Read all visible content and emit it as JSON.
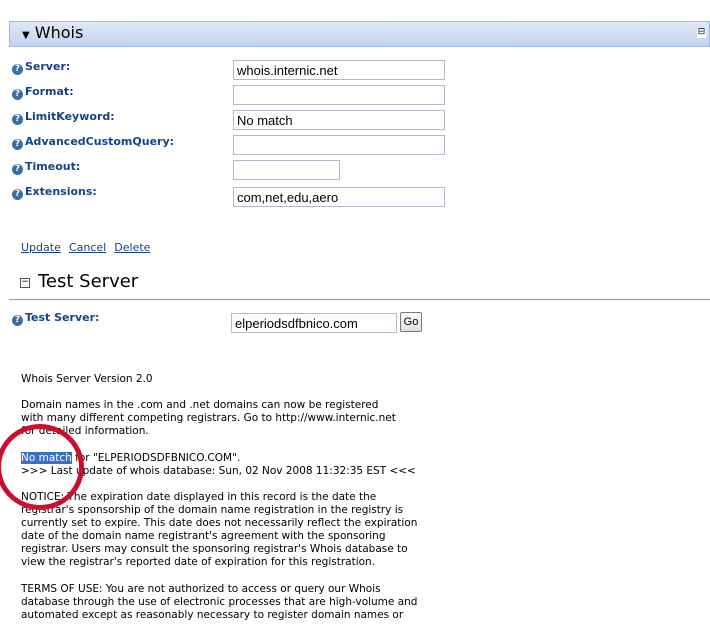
{
  "whois": {
    "title": "Whois",
    "collapse_glyph": "⊟",
    "fields": [
      {
        "label": "Server:",
        "value": "whois.internic.net"
      },
      {
        "label": "Format:",
        "value": ""
      },
      {
        "label": "LimitKeyword:",
        "value": "No match"
      },
      {
        "label": "AdvancedCustomQuery:",
        "value": ""
      },
      {
        "label": "Timeout:",
        "value": ""
      },
      {
        "label": "Extensions:",
        "value": "com,net,edu,aero"
      }
    ],
    "links": {
      "update": "Update",
      "cancel": "Cancel",
      "delete": "Delete"
    }
  },
  "test_server": {
    "title": "Test Server",
    "label": "Test Server:",
    "value": "elperiodsdfbnico.com",
    "go_label": "Go"
  },
  "output": {
    "version": "Whois Server Version 2.0",
    "p1": [
      "Domain names in the .com and .net domains can now be registered",
      "with many different competing registrars. Go to http://www.internic.net",
      "for detailed information."
    ],
    "nomatch_highlight": "No match",
    "nomatch_rest": " for \"ELPERIODSDFBNICO.COM\".",
    "last_update": ">>> Last update of whois database: Sun, 02 Nov 2008 11:32:35 EST <<<",
    "notice": [
      "NOTICE: The expiration date displayed in this record is the date the",
      "registrar's sponsorship of the domain name registration in the registry is",
      "currently set to expire. This date does not necessarily reflect the expiration",
      "date of the domain name registrant's agreement with the sponsoring",
      "registrar. Users may consult the sponsoring registrar's Whois database to",
      "view the registrar's reported date of expiration for this registration."
    ],
    "terms": [
      "TERMS OF USE: You are not authorized to access or query our Whois",
      "database through the use of electronic processes that are high-volume and",
      "automated except as reasonably necessary to register domain names or"
    ]
  }
}
